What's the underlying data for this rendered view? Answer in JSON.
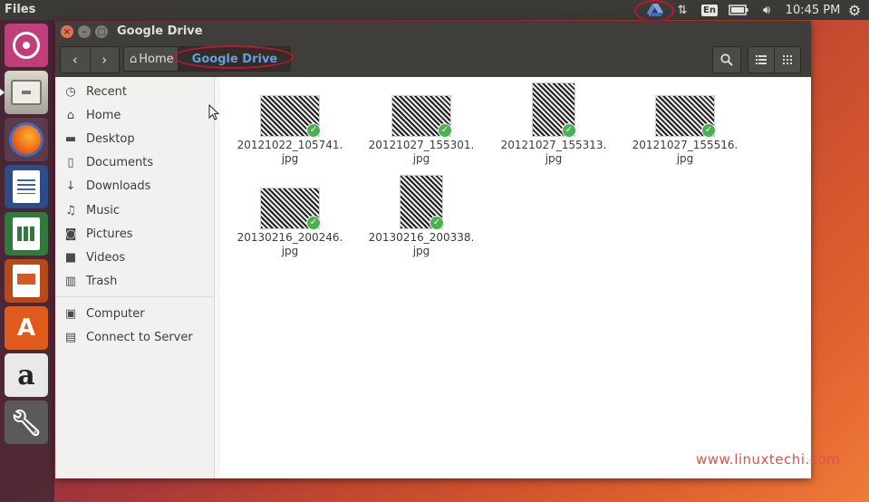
{
  "top_panel": {
    "app_name": "Files",
    "keyboard": "En",
    "clock": "10:45 PM"
  },
  "window": {
    "title": "Google Drive",
    "breadcrumb": {
      "home": "Home",
      "current": "Google Drive"
    }
  },
  "sidebar": {
    "items": [
      {
        "label": "Recent",
        "icon": "clock-icon"
      },
      {
        "label": "Home",
        "icon": "home-icon"
      },
      {
        "label": "Desktop",
        "icon": "folder-icon"
      },
      {
        "label": "Documents",
        "icon": "document-icon"
      },
      {
        "label": "Downloads",
        "icon": "download-icon"
      },
      {
        "label": "Music",
        "icon": "music-icon"
      },
      {
        "label": "Pictures",
        "icon": "camera-icon"
      },
      {
        "label": "Videos",
        "icon": "video-icon"
      },
      {
        "label": "Trash",
        "icon": "trash-icon"
      }
    ],
    "devices": [
      {
        "label": "Computer",
        "icon": "computer-icon"
      },
      {
        "label": "Connect to Server",
        "icon": "server-icon"
      }
    ]
  },
  "files": [
    {
      "line1": "20121022_105741.",
      "line2": "jpg"
    },
    {
      "line1": "20121027_155301.",
      "line2": "jpg"
    },
    {
      "line1": "20121027_155313.",
      "line2": "jpg"
    },
    {
      "line1": "20121027_155516.",
      "line2": "jpg"
    },
    {
      "line1": "20130216_200246.",
      "line2": "jpg"
    },
    {
      "line1": "20130216_200338.",
      "line2": "jpg"
    }
  ],
  "watermark": "www.linuxtechi.com"
}
